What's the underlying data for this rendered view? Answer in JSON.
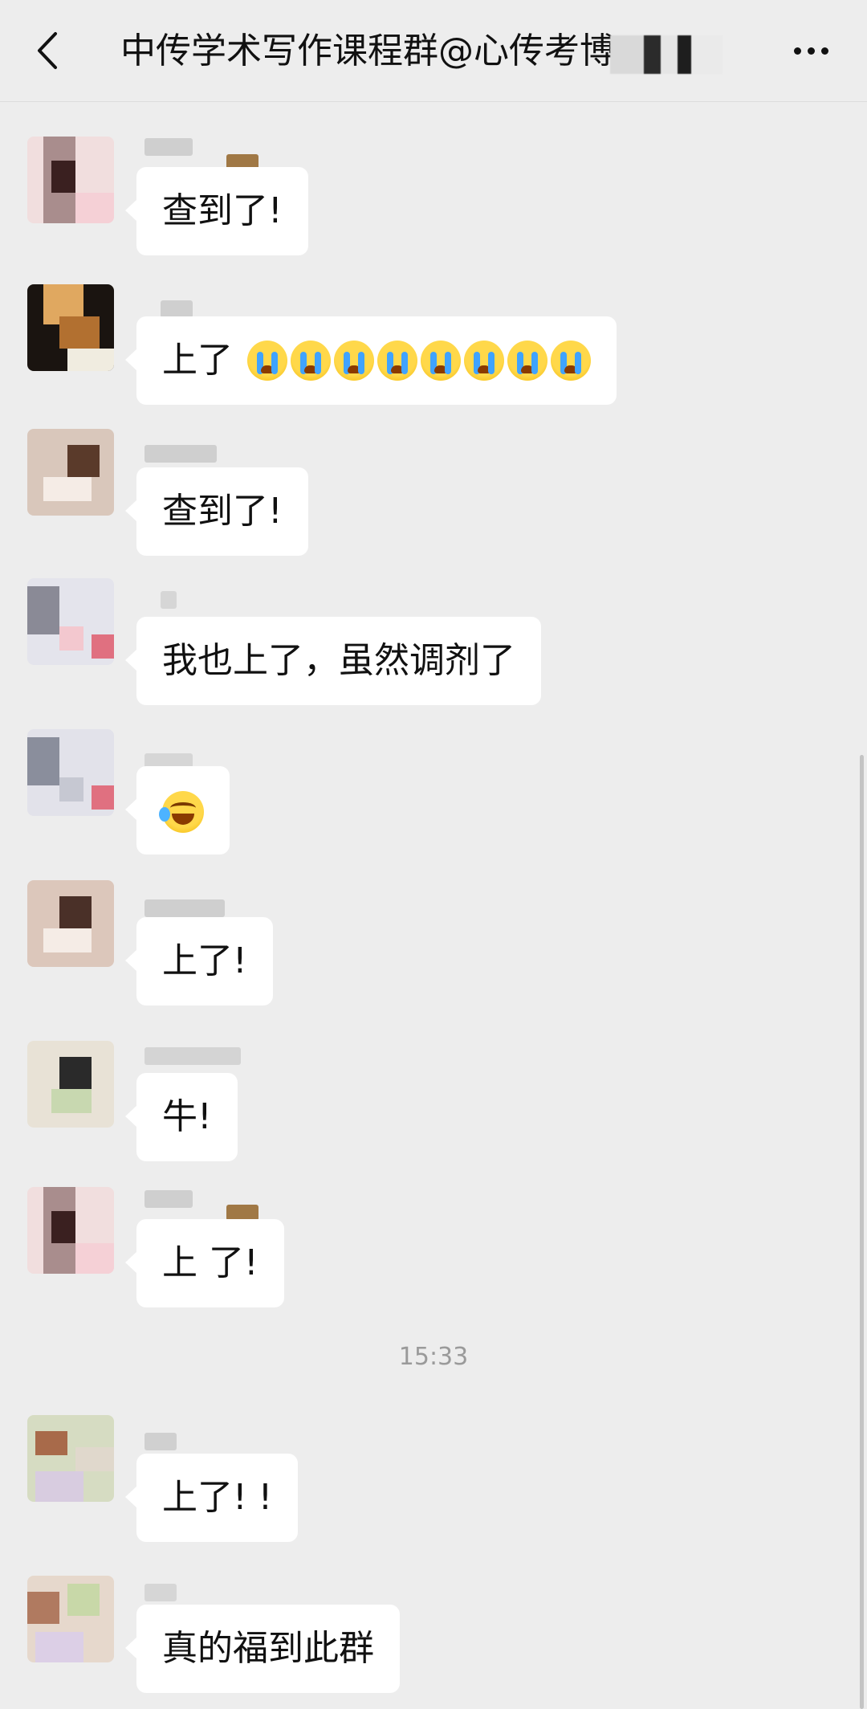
{
  "header": {
    "title": "中传学术写作课程群@心传考博",
    "back_icon": "chevron-left-icon",
    "more_icon": "ellipsis-icon"
  },
  "messages": [
    {
      "text": "查到了!"
    },
    {
      "text": "上了",
      "emoji": "loudly-crying-face",
      "emoji_count": 8
    },
    {
      "text": "查到了!"
    },
    {
      "text": "我也上了，虽然调剂了"
    },
    {
      "text": "",
      "emoji": "rolling-on-floor-laughing"
    },
    {
      "text": "上了!"
    },
    {
      "text": "牛!"
    },
    {
      "text": "上 了!"
    },
    {
      "text": "上了! !"
    },
    {
      "text": "真的福到此群"
    }
  ],
  "timestamp": "15:33",
  "colors": {
    "background": "#ededed",
    "bubble": "#ffffff",
    "text": "#111111",
    "timestamp": "#9a9a9a"
  }
}
